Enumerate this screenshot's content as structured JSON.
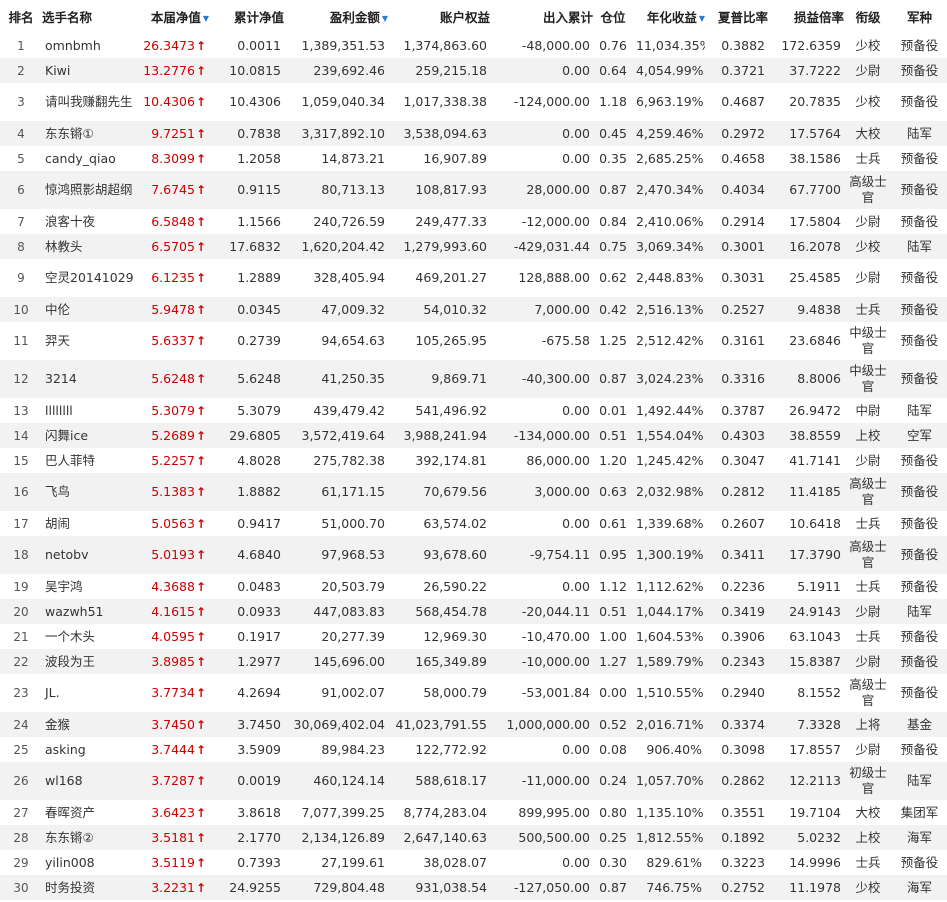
{
  "header": {
    "rank": "排名",
    "name": "选手名称",
    "net": "本届净值",
    "cum": "累计净值",
    "profit": "盈利金额",
    "equity": "账户权益",
    "flow": "出入累计",
    "pos": "仓位",
    "annual": "年化收益",
    "sharpe": "夏普比率",
    "ratio": "损益倍率",
    "grade": "衔级",
    "corps": "军种"
  },
  "rows": [
    {
      "rank": "1",
      "name": "omnbmh",
      "net": "26.3473",
      "cum": "0.0011",
      "profit": "1,389,351.53",
      "equity": "1,374,863.60",
      "flow": "-48,000.00",
      "pos": "0.76",
      "annual": "11,034.35%",
      "sharpe": "0.3882",
      "ratio": "172.6359",
      "grade": "少校",
      "corps": "预备役",
      "h": 25
    },
    {
      "rank": "2",
      "name": "Kiwi",
      "net": "13.2776",
      "cum": "10.0815",
      "profit": "239,692.46",
      "equity": "259,215.18",
      "flow": "0.00",
      "pos": "0.64",
      "annual": "4,054.99%",
      "sharpe": "0.3721",
      "ratio": "37.7222",
      "grade": "少尉",
      "corps": "预备役",
      "h": 25
    },
    {
      "rank": "3",
      "name": "请叫我赚翻先生",
      "net": "10.4306",
      "cum": "10.4306",
      "profit": "1,059,040.34",
      "equity": "1,017,338.38",
      "flow": "-124,000.00",
      "pos": "1.18",
      "annual": "6,963.19%",
      "sharpe": "0.4687",
      "ratio": "20.7835",
      "grade": "少校",
      "corps": "预备役",
      "h": 38
    },
    {
      "rank": "4",
      "name": "东东锵①",
      "net": "9.7251",
      "cum": "0.7838",
      "profit": "3,317,892.10",
      "equity": "3,538,094.63",
      "flow": "0.00",
      "pos": "0.45",
      "annual": "4,259.46%",
      "sharpe": "0.2972",
      "ratio": "17.5764",
      "grade": "大校",
      "corps": "陆军",
      "h": 25
    },
    {
      "rank": "5",
      "name": "candy_qiao",
      "net": "8.3099",
      "cum": "1.2058",
      "profit": "14,873.21",
      "equity": "16,907.89",
      "flow": "0.00",
      "pos": "0.35",
      "annual": "2,685.25%",
      "sharpe": "0.4658",
      "ratio": "38.1586",
      "grade": "士兵",
      "corps": "预备役",
      "h": 25
    },
    {
      "rank": "6",
      "name": "惊鸿照影胡超纲",
      "net": "7.6745",
      "cum": "0.9115",
      "profit": "80,713.13",
      "equity": "108,817.93",
      "flow": "28,000.00",
      "pos": "0.87",
      "annual": "2,470.34%",
      "sharpe": "0.4034",
      "ratio": "67.7700",
      "grade": "高级士官",
      "corps": "预备役",
      "h": 38
    },
    {
      "rank": "7",
      "name": "浪客十夜",
      "net": "6.5848",
      "cum": "1.1566",
      "profit": "240,726.59",
      "equity": "249,477.33",
      "flow": "-12,000.00",
      "pos": "0.84",
      "annual": "2,410.06%",
      "sharpe": "0.2914",
      "ratio": "17.5804",
      "grade": "少尉",
      "corps": "预备役",
      "h": 25
    },
    {
      "rank": "8",
      "name": "林教头",
      "net": "6.5705",
      "cum": "17.6832",
      "profit": "1,620,204.42",
      "equity": "1,279,993.60",
      "flow": "-429,031.44",
      "pos": "0.75",
      "annual": "3,069.34%",
      "sharpe": "0.3001",
      "ratio": "16.2078",
      "grade": "少校",
      "corps": "陆军",
      "h": 25
    },
    {
      "rank": "9",
      "name": "空灵20141029",
      "net": "6.1235",
      "cum": "1.2889",
      "profit": "328,405.94",
      "equity": "469,201.27",
      "flow": "128,888.00",
      "pos": "0.62",
      "annual": "2,448.83%",
      "sharpe": "0.3031",
      "ratio": "25.4585",
      "grade": "少尉",
      "corps": "预备役",
      "h": 38
    },
    {
      "rank": "10",
      "name": "中伦",
      "net": "5.9478",
      "cum": "0.0345",
      "profit": "47,009.32",
      "equity": "54,010.32",
      "flow": "7,000.00",
      "pos": "0.42",
      "annual": "2,516.13%",
      "sharpe": "0.2527",
      "ratio": "9.4838",
      "grade": "士兵",
      "corps": "预备役",
      "h": 25
    },
    {
      "rank": "11",
      "name": "羿天",
      "net": "5.6337",
      "cum": "0.2739",
      "profit": "94,654.63",
      "equity": "105,265.95",
      "flow": "-675.58",
      "pos": "1.25",
      "annual": "2,512.42%",
      "sharpe": "0.3161",
      "ratio": "23.6846",
      "grade": "中级士官",
      "corps": "预备役",
      "h": 38
    },
    {
      "rank": "12",
      "name": "3214",
      "net": "5.6248",
      "cum": "5.6248",
      "profit": "41,250.35",
      "equity": "9,869.71",
      "flow": "-40,300.00",
      "pos": "0.87",
      "annual": "3,024.23%",
      "sharpe": "0.3316",
      "ratio": "8.8006",
      "grade": "中级士官",
      "corps": "预备役",
      "h": 38
    },
    {
      "rank": "13",
      "name": "llllllll",
      "net": "5.3079",
      "cum": "5.3079",
      "profit": "439,479.42",
      "equity": "541,496.92",
      "flow": "0.00",
      "pos": "0.01",
      "annual": "1,492.44%",
      "sharpe": "0.3787",
      "ratio": "26.9472",
      "grade": "中尉",
      "corps": "陆军",
      "h": 25
    },
    {
      "rank": "14",
      "name": "闪舞ice",
      "net": "5.2689",
      "cum": "29.6805",
      "profit": "3,572,419.64",
      "equity": "3,988,241.94",
      "flow": "-134,000.00",
      "pos": "0.51",
      "annual": "1,554.04%",
      "sharpe": "0.4303",
      "ratio": "38.8559",
      "grade": "上校",
      "corps": "空军",
      "h": 25
    },
    {
      "rank": "15",
      "name": "巴人菲特",
      "net": "5.2257",
      "cum": "4.8028",
      "profit": "275,782.38",
      "equity": "392,174.81",
      "flow": "86,000.00",
      "pos": "1.20",
      "annual": "1,245.42%",
      "sharpe": "0.3047",
      "ratio": "41.7141",
      "grade": "少尉",
      "corps": "预备役",
      "h": 25
    },
    {
      "rank": "16",
      "name": "飞鸟",
      "net": "5.1383",
      "cum": "1.8882",
      "profit": "61,171.15",
      "equity": "70,679.56",
      "flow": "3,000.00",
      "pos": "0.63",
      "annual": "2,032.98%",
      "sharpe": "0.2812",
      "ratio": "11.4185",
      "grade": "高级士官",
      "corps": "预备役",
      "h": 38
    },
    {
      "rank": "17",
      "name": "胡闹",
      "net": "5.0563",
      "cum": "0.9417",
      "profit": "51,000.70",
      "equity": "63,574.02",
      "flow": "0.00",
      "pos": "0.61",
      "annual": "1,339.68%",
      "sharpe": "0.2607",
      "ratio": "10.6418",
      "grade": "士兵",
      "corps": "预备役",
      "h": 25
    },
    {
      "rank": "18",
      "name": "netobv",
      "net": "5.0193",
      "cum": "4.6840",
      "profit": "97,968.53",
      "equity": "93,678.60",
      "flow": "-9,754.11",
      "pos": "0.95",
      "annual": "1,300.19%",
      "sharpe": "0.3411",
      "ratio": "17.3790",
      "grade": "高级士官",
      "corps": "预备役",
      "h": 38
    },
    {
      "rank": "19",
      "name": "吴宇鸿",
      "net": "4.3688",
      "cum": "0.0483",
      "profit": "20,503.79",
      "equity": "26,590.22",
      "flow": "0.00",
      "pos": "1.12",
      "annual": "1,112.62%",
      "sharpe": "0.2236",
      "ratio": "5.1911",
      "grade": "士兵",
      "corps": "预备役",
      "h": 25
    },
    {
      "rank": "20",
      "name": "wazwh51",
      "net": "4.1615",
      "cum": "0.0933",
      "profit": "447,083.83",
      "equity": "568,454.78",
      "flow": "-20,044.11",
      "pos": "0.51",
      "annual": "1,044.17%",
      "sharpe": "0.3419",
      "ratio": "24.9143",
      "grade": "少尉",
      "corps": "陆军",
      "h": 25
    },
    {
      "rank": "21",
      "name": "一个木头",
      "net": "4.0595",
      "cum": "0.1917",
      "profit": "20,277.39",
      "equity": "12,969.30",
      "flow": "-10,470.00",
      "pos": "1.00",
      "annual": "1,604.53%",
      "sharpe": "0.3906",
      "ratio": "63.1043",
      "grade": "士兵",
      "corps": "预备役",
      "h": 25
    },
    {
      "rank": "22",
      "name": "波段为王",
      "net": "3.8985",
      "cum": "1.2977",
      "profit": "145,696.00",
      "equity": "165,349.89",
      "flow": "-10,000.00",
      "pos": "1.27",
      "annual": "1,589.79%",
      "sharpe": "0.2343",
      "ratio": "15.8387",
      "grade": "少尉",
      "corps": "预备役",
      "h": 25
    },
    {
      "rank": "23",
      "name": "JL.",
      "net": "3.7734",
      "cum": "4.2694",
      "profit": "91,002.07",
      "equity": "58,000.79",
      "flow": "-53,001.84",
      "pos": "0.00",
      "annual": "1,510.55%",
      "sharpe": "0.2940",
      "ratio": "8.1552",
      "grade": "高级士官",
      "corps": "预备役",
      "h": 38
    },
    {
      "rank": "24",
      "name": "金猴",
      "net": "3.7450",
      "cum": "3.7450",
      "profit": "30,069,402.04",
      "equity": "41,023,791.55",
      "flow": "1,000,000.00",
      "pos": "0.52",
      "annual": "2,016.71%",
      "sharpe": "0.3374",
      "ratio": "7.3328",
      "grade": "上将",
      "corps": "基金",
      "h": 25
    },
    {
      "rank": "25",
      "name": "asking",
      "net": "3.7444",
      "cum": "3.5909",
      "profit": "89,984.23",
      "equity": "122,772.92",
      "flow": "0.00",
      "pos": "0.08",
      "annual": "906.40%",
      "sharpe": "0.3098",
      "ratio": "17.8557",
      "grade": "少尉",
      "corps": "预备役",
      "h": 25
    },
    {
      "rank": "26",
      "name": "wl168",
      "net": "3.7287",
      "cum": "0.0019",
      "profit": "460,124.14",
      "equity": "588,618.17",
      "flow": "-11,000.00",
      "pos": "0.24",
      "annual": "1,057.70%",
      "sharpe": "0.2862",
      "ratio": "12.2113",
      "grade": "初级士官",
      "corps": "陆军",
      "h": 38
    },
    {
      "rank": "27",
      "name": "春晖资产",
      "net": "3.6423",
      "cum": "3.8618",
      "profit": "7,077,399.25",
      "equity": "8,774,283.04",
      "flow": "899,995.00",
      "pos": "0.80",
      "annual": "1,135.10%",
      "sharpe": "0.3551",
      "ratio": "19.7104",
      "grade": "大校",
      "corps": "集团军",
      "h": 25
    },
    {
      "rank": "28",
      "name": "东东锵②",
      "net": "3.5181",
      "cum": "2.1770",
      "profit": "2,134,126.89",
      "equity": "2,647,140.63",
      "flow": "500,500.00",
      "pos": "0.25",
      "annual": "1,812.55%",
      "sharpe": "0.1892",
      "ratio": "5.0232",
      "grade": "上校",
      "corps": "海军",
      "h": 25
    },
    {
      "rank": "29",
      "name": "yilin008",
      "net": "3.5119",
      "cum": "0.7393",
      "profit": "27,199.61",
      "equity": "38,028.07",
      "flow": "0.00",
      "pos": "0.30",
      "annual": "829.61%",
      "sharpe": "0.3223",
      "ratio": "14.9996",
      "grade": "士兵",
      "corps": "预备役",
      "h": 25
    },
    {
      "rank": "30",
      "name": "时务投资",
      "net": "3.2231",
      "cum": "24.9255",
      "profit": "729,804.48",
      "equity": "931,038.54",
      "flow": "-127,050.00",
      "pos": "0.87",
      "annual": "746.75%",
      "sharpe": "0.2752",
      "ratio": "11.1978",
      "grade": "少校",
      "corps": "海军",
      "h": 25
    }
  ],
  "icons": {
    "sort": "sort-down-icon",
    "up": "red-up-arrow-icon"
  },
  "colors": {
    "net_value": "#cc0000",
    "sort_arrow": "#2b7bd4",
    "stripe": "#f2f2f2"
  }
}
